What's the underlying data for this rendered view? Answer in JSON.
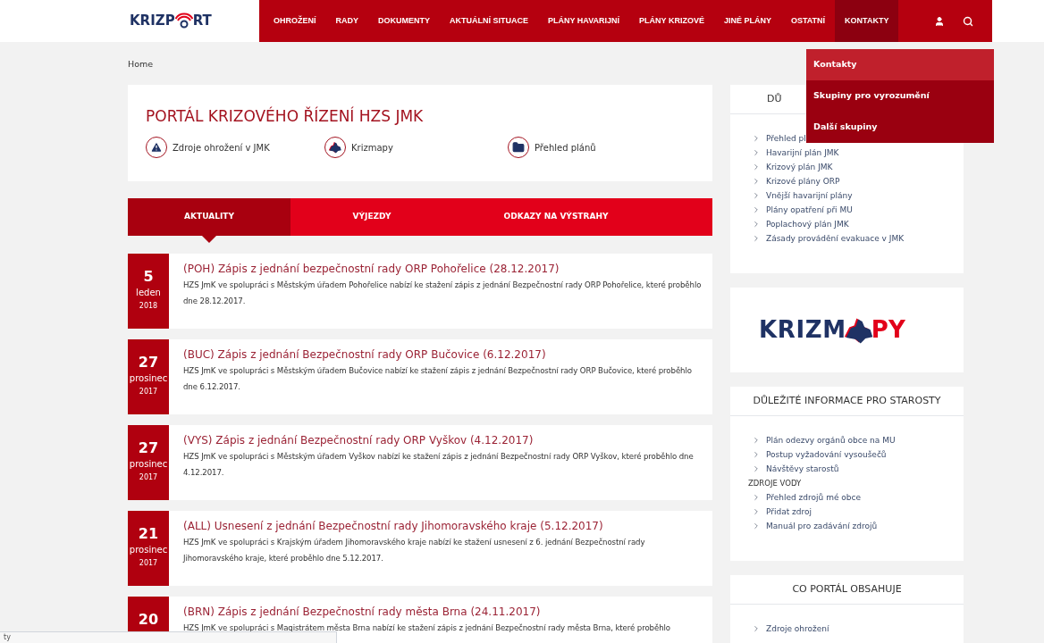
{
  "header": {
    "logo": {
      "left": "KRIZP",
      "right": "RT"
    },
    "nav": [
      {
        "label": "OHROŽENÍ",
        "selected": false
      },
      {
        "label": "RADY",
        "selected": false
      },
      {
        "label": "DOKUMENTY",
        "selected": false
      },
      {
        "label": "AKTUÁLNÍ SITUACE",
        "selected": false
      },
      {
        "label": "PLÁNY HAVARIJNÍ",
        "selected": false
      },
      {
        "label": "PLÁNY KRIZOVÉ",
        "selected": false
      },
      {
        "label": "JINÉ PLÁNY",
        "selected": false
      },
      {
        "label": "OSTATNÍ",
        "selected": false
      },
      {
        "label": "KONTAKTY",
        "selected": true
      }
    ],
    "dropdown": [
      {
        "label": "Kontakty",
        "selected": true
      },
      {
        "label": "Skupiny pro vyrozumění",
        "selected": false
      },
      {
        "label": "Další skupiny",
        "selected": false
      }
    ]
  },
  "breadcrumb": "Home",
  "hero": {
    "title": "PORTÁL KRIZOVÉHO ŘÍZENÍ HZS JMK",
    "links": [
      {
        "label": "Zdroje ohrožení v JMK",
        "kind": "warning"
      },
      {
        "label": "Krizmapy",
        "kind": "map"
      },
      {
        "label": "Přehled plánů",
        "kind": "folder"
      }
    ]
  },
  "tabs": [
    {
      "label": "AKTUALITY",
      "selected": true
    },
    {
      "label": "VÝJEZDY",
      "selected": false
    },
    {
      "label": "ODKAZY NA VÝSTRAHY",
      "selected": false
    }
  ],
  "news": [
    {
      "day": "5",
      "month": "leden",
      "year": "2018",
      "title": "(POH) Zápis z jednání bezpečnostní rady ORP Pohořelice (28.12.2017)",
      "text": "HZS JmK ve spolupráci s Městským úřadem Pohořelice nabízí ke stažení zápis z jednání Bezpečnostní rady ORP Pohořelice, které proběhlo dne 28.12.2017."
    },
    {
      "day": "27",
      "month": "prosinec",
      "year": "2017",
      "title": "(BUC) Zápis z jednání Bezpečnostní rady ORP Bučovice (6.12.2017)",
      "text": "HZS JmK ve spolupráci s Městským úřadem Bučovice nabízí ke stažení zápis z jednání Bezpečnostní rady ORP Bučovice, které proběhlo dne 6.12.2017."
    },
    {
      "day": "27",
      "month": "prosinec",
      "year": "2017",
      "title": "(VYS) Zápis z jednání Bezpečnostní rady ORP Vyškov (4.12.2017)",
      "text": "HZS JmK ve spolupráci s Městským úřadem Vyškov nabízí ke stažení zápis z jednání Bezpečnostní rady ORP Vyškov, které proběhlo dne 4.12.2017."
    },
    {
      "day": "21",
      "month": "prosinec",
      "year": "2017",
      "title": "(ALL) Usnesení z jednání Bezpečnostní rady Jihomoravského kraje (5.12.2017)",
      "text": "HZS JmK ve spolupráci s Krajským úřadem Jihomoravského kraje nabízí ke stažení usnesení z 6. jednání Bezpečnostní rady Jihomoravského kraje, které proběhlo dne 5.12.2017."
    },
    {
      "day": "20",
      "title": "(BRN) Zápis z jednání Bezpečnostní rady města Brna (24.11.2017)",
      "text": "HZS JmK ve spolupráci s Magistrátem města Brna nabízí ke stažení zápis z jednání Bezpečnostní rady města Brna, které proběhlo"
    }
  ],
  "sidebar": [
    {
      "kind": "list",
      "title": "DŮ",
      "items": [
        {
          "kind": "link",
          "label": "Přehled pl"
        },
        {
          "kind": "link",
          "label": "Havarijní plán JMK"
        },
        {
          "kind": "link",
          "label": "Krizový plán JMK"
        },
        {
          "kind": "link",
          "label": "Krizové plány ORP"
        },
        {
          "kind": "link",
          "label": "Vnější havarijní plány"
        },
        {
          "kind": "link",
          "label": "Plány opatření při MU"
        },
        {
          "kind": "link",
          "label": "Poplachový plán JMK"
        },
        {
          "kind": "link",
          "label": "Zásady provádění evakuace v JMK"
        }
      ]
    },
    {
      "kind": "logo",
      "left": "KRIZM",
      "right": "PY"
    },
    {
      "kind": "list",
      "title": "DŮLEŽITÉ INFORMACE PRO STAROSTY",
      "items": [
        {
          "kind": "link",
          "label": "Plán odezvy orgánů obce na MU"
        },
        {
          "kind": "link",
          "label": "Postup vyžadování vysoušečů"
        },
        {
          "kind": "link",
          "label": "Návštěvy starostů"
        },
        {
          "kind": "heading",
          "label": "ZDROJE VODY"
        },
        {
          "kind": "link",
          "label": "Přehled zdrojů mé obce"
        },
        {
          "kind": "link",
          "label": "Přidat zdroj"
        },
        {
          "kind": "link",
          "label": "Manuál pro zadávání zdrojů"
        }
      ]
    },
    {
      "kind": "list",
      "title": "CO PORTÁL OBSAHUJE",
      "items": [
        {
          "kind": "link",
          "label": "Zdroje ohrožení"
        }
      ]
    }
  ],
  "status_bar": "ty"
}
